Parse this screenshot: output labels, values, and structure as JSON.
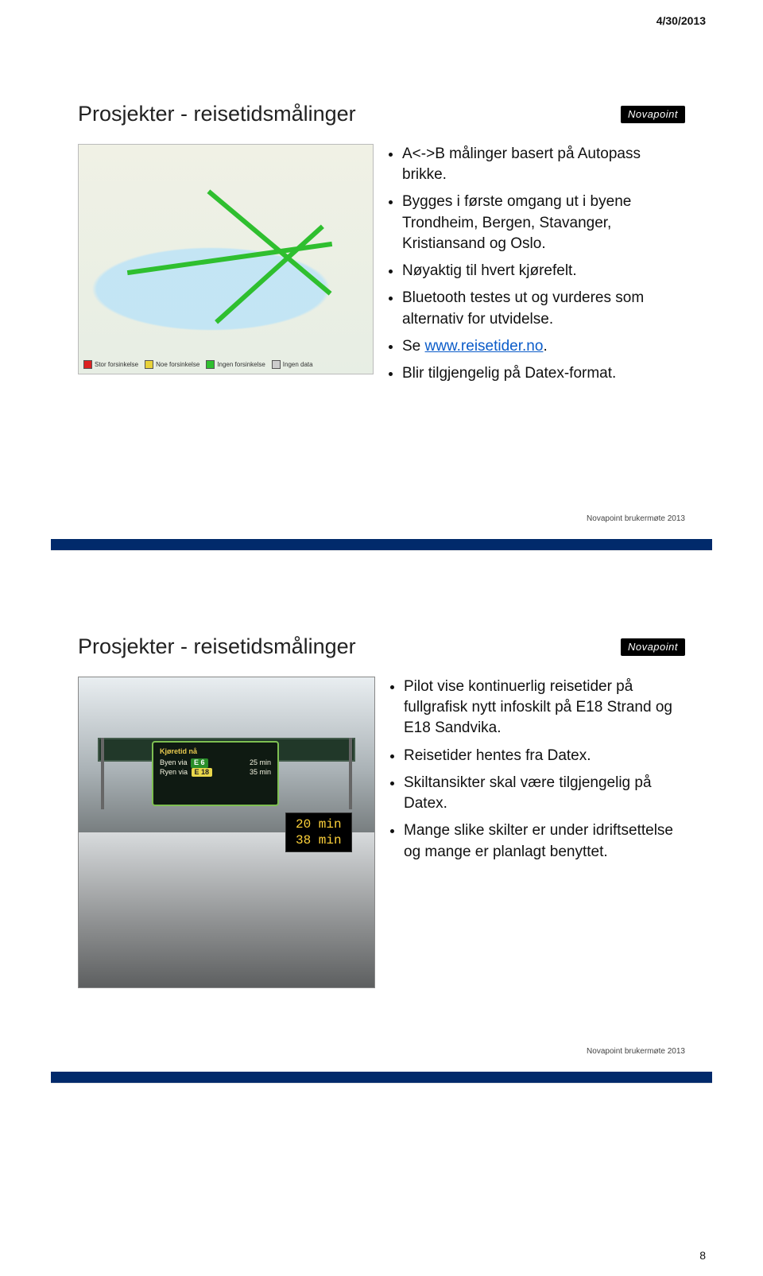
{
  "header_date": "4/30/2013",
  "page_number": "8",
  "brand": "Novapoint",
  "footer_line": "Novapoint brukermøte 2013",
  "slide1": {
    "title": "Prosjekter - reisetidsmålinger",
    "legend": {
      "a": "Stor forsinkelse",
      "b": "Noe forsinkelse",
      "c": "Ingen forsinkelse",
      "d": "Ingen data"
    },
    "bullets": {
      "b1": "A<->B målinger basert på Autopass brikke.",
      "b2": "Bygges i første omgang ut i byene Trondheim, Bergen, Stavanger, Kristiansand og Oslo.",
      "b3": "Nøyaktig til hvert kjørefelt.",
      "b4": "Bluetooth testes ut og vurderes som alternativ for utvidelse.",
      "b5a": "Se ",
      "b5_link": "www.reisetider.no",
      "b5b": ".",
      "b6": "Blir tilgjengelig på Datex-format."
    }
  },
  "slide2": {
    "title": "Prosjekter - reisetidsmålinger",
    "sign": {
      "heading": "Kjøretid nå",
      "row1_dest": "Byen via",
      "row1_route": "E 6",
      "row1_time": "25 min",
      "row2_dest": "Ryen via",
      "row2_route": "E 18",
      "row2_time": "35 min"
    },
    "led": {
      "line1": "20 min",
      "line2": "38 min"
    },
    "bullets": {
      "b1": "Pilot vise kontinuerlig reisetider på fullgrafisk nytt infoskilt på E18 Strand og E18 Sandvika.",
      "b2": "Reisetider hentes fra Datex.",
      "b3": "Skiltansikter skal være tilgjengelig på Datex.",
      "b4": "Mange slike skilter er under idriftsettelse og mange er planlagt benyttet."
    }
  }
}
